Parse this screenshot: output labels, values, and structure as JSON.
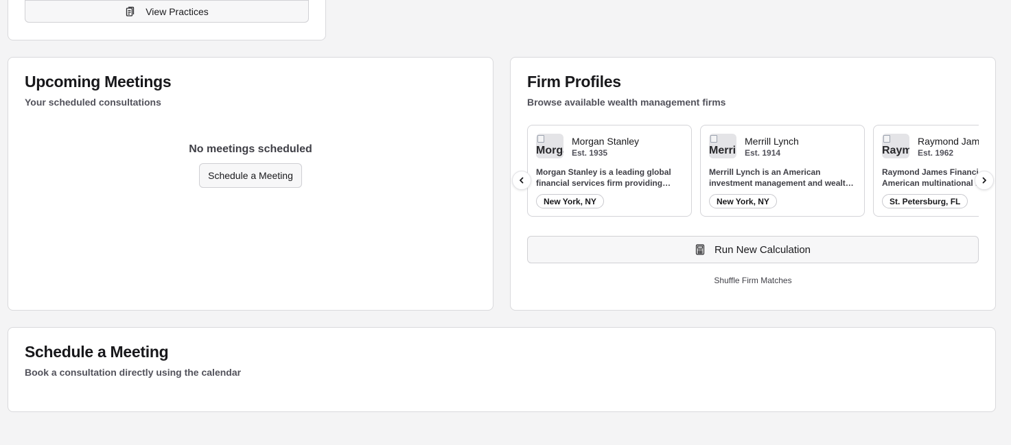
{
  "practices": {
    "view_label": "View Practices"
  },
  "meetings": {
    "title": "Upcoming Meetings",
    "subtitle": "Your scheduled consultations",
    "empty_text": "No meetings scheduled",
    "schedule_label": "Schedule a Meeting"
  },
  "firms": {
    "title": "Firm Profiles",
    "subtitle": "Browse available wealth management firms",
    "items": [
      {
        "logo_alt": "Morgan Stanley",
        "name": "Morgan Stanley",
        "est": "Est. 1935",
        "desc": "Morgan Stanley is a leading global financial services firm providing investment banking and wealth management.",
        "location": "New York, NY"
      },
      {
        "logo_alt": "Merrill Lynch",
        "name": "Merrill Lynch",
        "est": "Est. 1914",
        "desc": "Merrill Lynch is an American investment management and wealth management division.",
        "location": "New York, NY"
      },
      {
        "logo_alt": "Raymond James",
        "name": "Raymond James",
        "est": "Est. 1962",
        "desc": "Raymond James Financial is an American multinational independent investment bank.",
        "location": "St. Petersburg, FL"
      }
    ],
    "calc_label": "Run New Calculation",
    "shuffle_label": "Shuffle Firm Matches"
  },
  "schedule": {
    "title": "Schedule a Meeting",
    "subtitle": "Book a consultation directly using the calendar"
  }
}
